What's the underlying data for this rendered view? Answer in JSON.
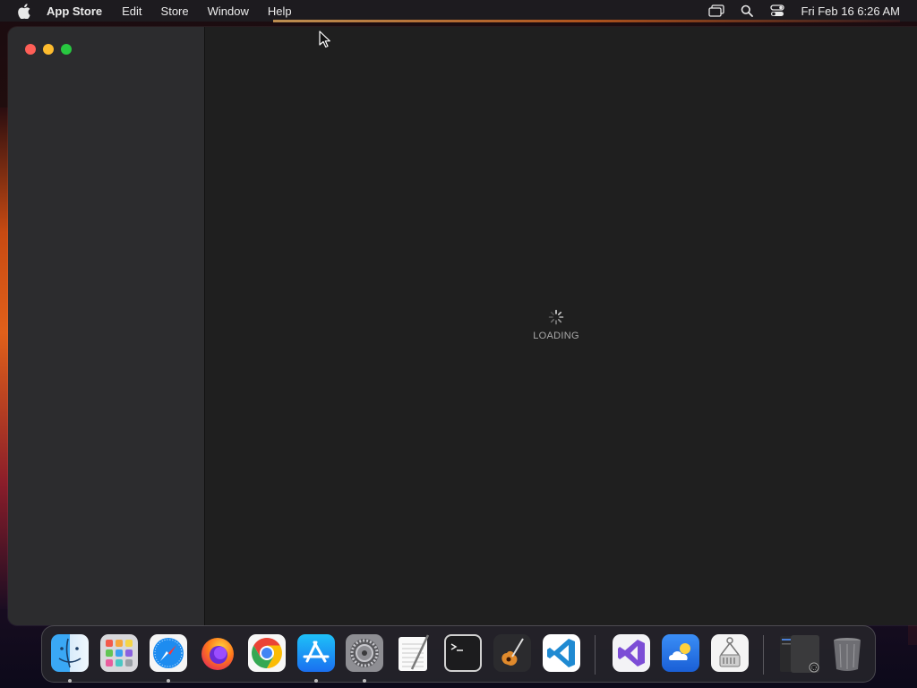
{
  "menubar": {
    "app_name": "App Store",
    "items": [
      "Edit",
      "Store",
      "Window",
      "Help"
    ],
    "clock": "Fri Feb 16  6:26 AM",
    "status_icons": [
      "screen-mirroring-icon",
      "search-icon",
      "control-center-icon"
    ]
  },
  "window": {
    "loading_label": "LOADING"
  },
  "dock": {
    "items": [
      {
        "name": "finder",
        "running": true
      },
      {
        "name": "launchpad",
        "running": false
      },
      {
        "name": "safari",
        "running": true
      },
      {
        "name": "firefox",
        "running": false
      },
      {
        "name": "chrome",
        "running": false
      },
      {
        "name": "app-store",
        "running": true
      },
      {
        "name": "system-settings",
        "running": true
      },
      {
        "name": "textedit",
        "running": false
      },
      {
        "name": "terminal",
        "running": false
      },
      {
        "name": "garageband",
        "running": false
      },
      {
        "name": "vscode",
        "running": false
      },
      {
        "name": "visual-studio",
        "running": false
      },
      {
        "name": "weather-app",
        "running": false
      },
      {
        "name": "archive-utility",
        "running": false
      },
      {
        "name": "downloads-stack",
        "running": false
      },
      {
        "name": "trash",
        "running": false
      }
    ]
  },
  "colors": {
    "menubar_bg": "#1d1b1f",
    "window_bg": "#1f1f1f",
    "sidebar_bg": "#2c2c2e",
    "close": "#ff5f57",
    "minimize": "#febc2e",
    "maximize": "#28c840"
  }
}
